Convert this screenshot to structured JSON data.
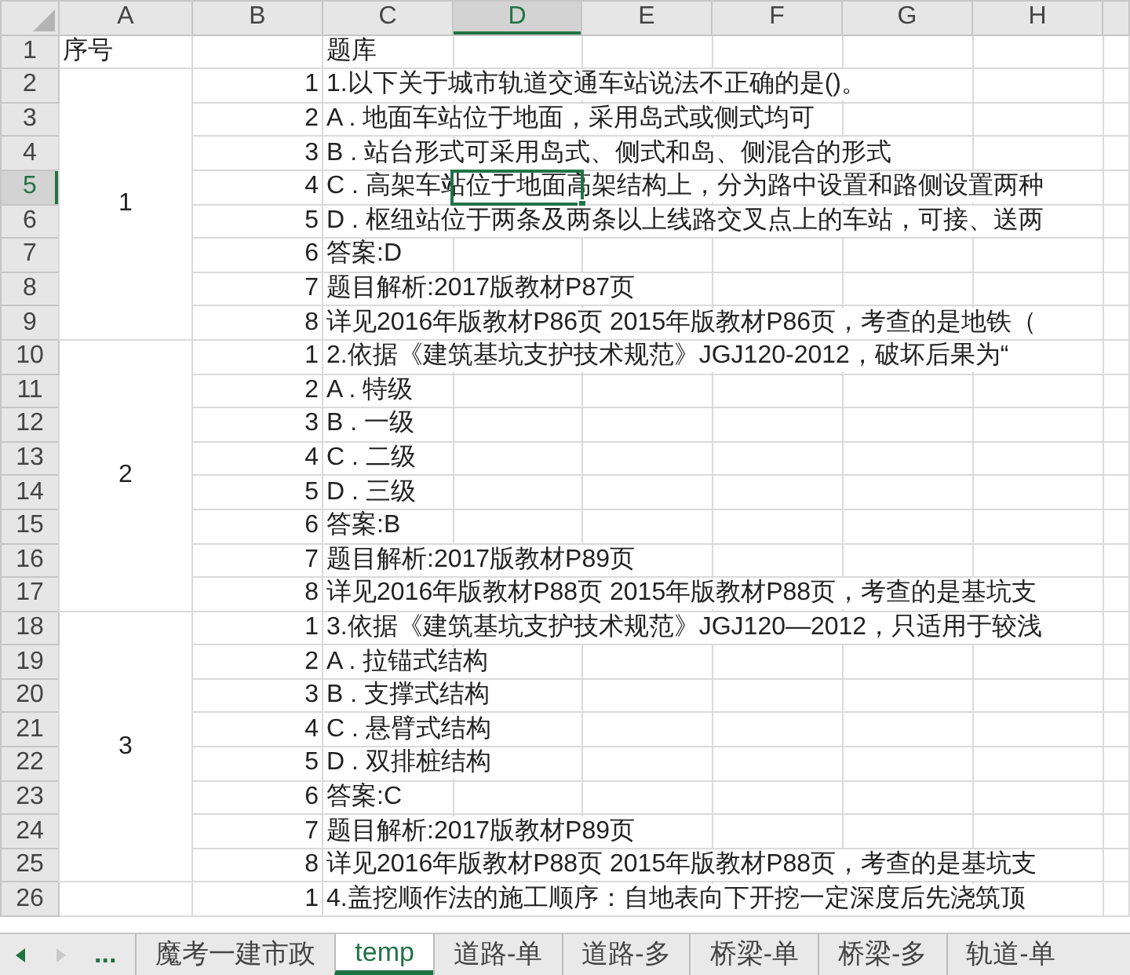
{
  "columns": [
    {
      "label": "A",
      "selected": false
    },
    {
      "label": "B",
      "selected": false
    },
    {
      "label": "C",
      "selected": false
    },
    {
      "label": "D",
      "selected": true
    },
    {
      "label": "E",
      "selected": false
    },
    {
      "label": "F",
      "selected": false
    },
    {
      "label": "G",
      "selected": false
    },
    {
      "label": "H",
      "selected": false
    }
  ],
  "header_row": {
    "number": "1",
    "selected": false,
    "a": "序号",
    "c": "题库"
  },
  "groups": [
    {
      "a": "1",
      "rows": [
        {
          "number": "2",
          "selected": false,
          "b": "1",
          "c": "1.以下关于城市轨道交通车站说法不正确的是()。"
        },
        {
          "number": "3",
          "selected": false,
          "b": "2",
          "c": "A . 地面车站位于地面，采用岛式或侧式均可"
        },
        {
          "number": "4",
          "selected": false,
          "b": "3",
          "c": "B . 站台形式可采用岛式、侧式和岛、侧混合的形式"
        },
        {
          "number": "5",
          "selected": true,
          "b": "4",
          "c": "C . 高架车站位于地面高架结构上，分为路中设置和路侧设置两种"
        },
        {
          "number": "6",
          "selected": false,
          "b": "5",
          "c": "D . 枢纽站位于两条及两条以上线路交叉点上的车站，可接、送两"
        },
        {
          "number": "7",
          "selected": false,
          "b": "6",
          "c": "答案:D"
        },
        {
          "number": "8",
          "selected": false,
          "b": "7",
          "c": "题目解析:2017版教材P87页"
        },
        {
          "number": "9",
          "selected": false,
          "b": "8",
          "c": "详见2016年版教材P86页 2015年版教材P86页，考查的是地铁（"
        }
      ]
    },
    {
      "a": "2",
      "rows": [
        {
          "number": "10",
          "selected": false,
          "b": "1",
          "c": "2.依据《建筑基坑支护技术规范》JGJ120-2012，破坏后果为“"
        },
        {
          "number": "11",
          "selected": false,
          "b": "2",
          "c": "A . 特级"
        },
        {
          "number": "12",
          "selected": false,
          "b": "3",
          "c": "B . 一级"
        },
        {
          "number": "13",
          "selected": false,
          "b": "4",
          "c": "C . 二级"
        },
        {
          "number": "14",
          "selected": false,
          "b": "5",
          "c": "D . 三级"
        },
        {
          "number": "15",
          "selected": false,
          "b": "6",
          "c": "答案:B"
        },
        {
          "number": "16",
          "selected": false,
          "b": "7",
          "c": "题目解析:2017版教材P89页"
        },
        {
          "number": "17",
          "selected": false,
          "b": "8",
          "c": "详见2016年版教材P88页 2015年版教材P88页，考查的是基坑支"
        }
      ]
    },
    {
      "a": "3",
      "rows": [
        {
          "number": "18",
          "selected": false,
          "b": "1",
          "c": "3.依据《建筑基坑支护技术规范》JGJ120—2012，只适用于较浅"
        },
        {
          "number": "19",
          "selected": false,
          "b": "2",
          "c": "A . 拉锚式结构"
        },
        {
          "number": "20",
          "selected": false,
          "b": "3",
          "c": "B . 支撑式结构"
        },
        {
          "number": "21",
          "selected": false,
          "b": "4",
          "c": "C . 悬臂式结构"
        },
        {
          "number": "22",
          "selected": false,
          "b": "5",
          "c": "D . 双排桩结构"
        },
        {
          "number": "23",
          "selected": false,
          "b": "6",
          "c": "答案:C"
        },
        {
          "number": "24",
          "selected": false,
          "b": "7",
          "c": "题目解析:2017版教材P89页"
        },
        {
          "number": "25",
          "selected": false,
          "b": "8",
          "c": "详见2016年版教材P88页 2015年版教材P88页，考查的是基坑支"
        }
      ]
    },
    {
      "rows": [
        {
          "number": "26",
          "selected": false,
          "b": "1",
          "c": "4.盖挖顺作法的施工顺序：自地表向下开挖一定深度后先浇筑顶"
        }
      ]
    }
  ],
  "sheet_tabs": {
    "more": "...",
    "tabs": [
      {
        "label": "魔考一建市政",
        "selected": false
      },
      {
        "label": "temp",
        "selected": true
      },
      {
        "label": "道路-单",
        "selected": false
      },
      {
        "label": "道路-多",
        "selected": false
      },
      {
        "label": "桥梁-单",
        "selected": false
      },
      {
        "label": "桥梁-多",
        "selected": false
      },
      {
        "label": "轨道-单",
        "selected": false
      }
    ]
  }
}
